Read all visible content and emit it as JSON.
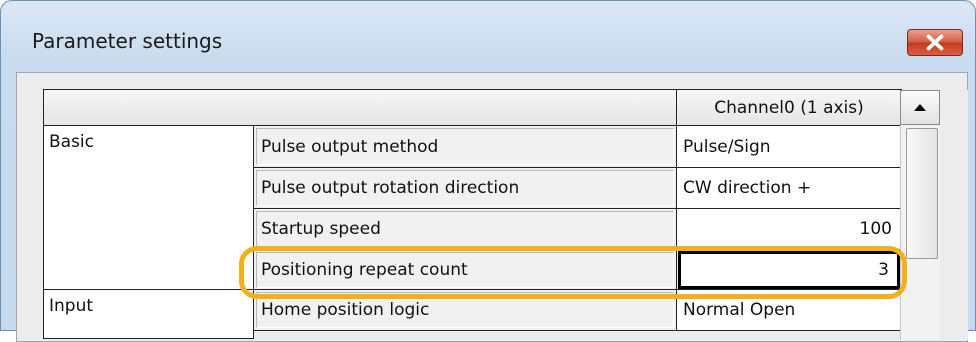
{
  "window": {
    "title": "Parameter settings"
  },
  "table": {
    "column_header": "Channel0 (1 axis)",
    "groups": [
      {
        "category": "Basic",
        "rows": [
          {
            "label": "Pulse output method",
            "value": "Pulse/Sign"
          },
          {
            "label": "Pulse output rotation direction",
            "value": "CW direction +"
          },
          {
            "label": "Startup speed",
            "value": "100"
          },
          {
            "label": "Positioning repeat count",
            "value": "3"
          }
        ]
      },
      {
        "category": "Input",
        "rows": [
          {
            "label": "Home position logic",
            "value": "Normal Open"
          }
        ]
      }
    ]
  },
  "highlight": {
    "color": "#f2b01d",
    "target": "Positioning repeat count"
  },
  "icons": {
    "close": "close-icon",
    "scroll_up": "scroll-up-arrow-icon"
  }
}
